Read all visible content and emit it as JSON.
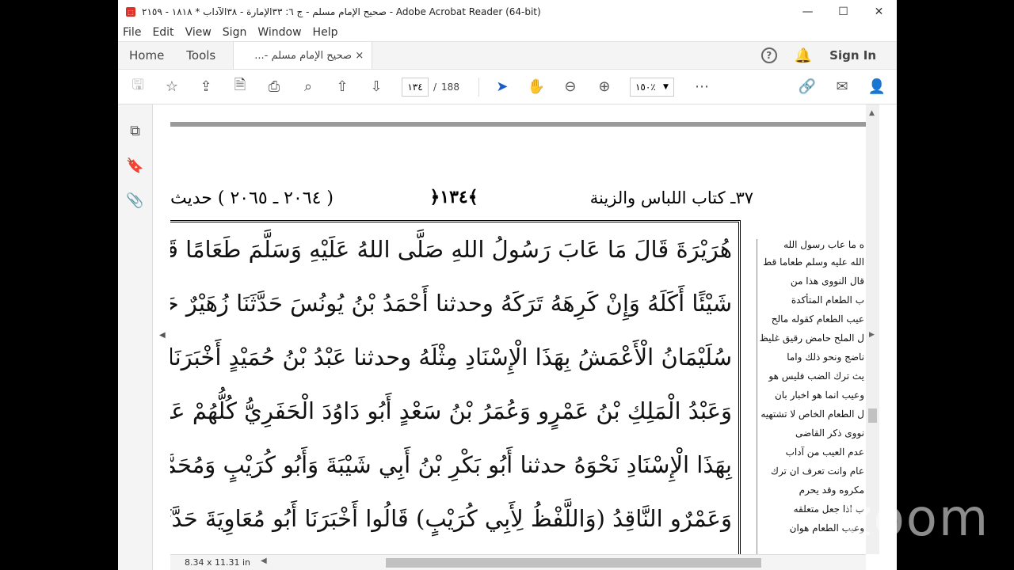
{
  "window": {
    "app_icon": "pdf-icon",
    "title": "صحيح الإمام مسلم - ج ٦: ٣٣الإمارة - ٣٨الآداب * ١٨١٨ - ٢١٥٩ - Adobe Acrobat Reader (64-bit)",
    "minimize": "—",
    "maximize": "☐",
    "close": "✕"
  },
  "menu": [
    "File",
    "Edit",
    "View",
    "Sign",
    "Window",
    "Help"
  ],
  "tabs": {
    "home": "Home",
    "tools": "Tools",
    "doc_tab": "صحيح الإمام مسلم -...",
    "doc_tab_close": "×",
    "help": "?",
    "sign_in": "Sign In"
  },
  "toolbar": {
    "page_current": "١٣٤",
    "page_separator": "/",
    "page_total": "188",
    "zoom": "١٥٠٪"
  },
  "document": {
    "header_left": "( ٢٠٦٤ ـ ٢٠٦٥ ) حديث",
    "header_center": "﴿١٣٤﴾",
    "header_right": "٣٧ـ كتاب اللباس والزينة",
    "lines": [
      "هُرَيْرَةَ قَالَ مَا عَابَ رَسُولُ اللهِ صَلَّى اللهُ عَلَيْهِ وَسَلَّمَ طَعَامًا قَطُّ كَانَ إِذَا اشْتَهَى",
      "شَيْئًا أَكَلَهُ وَإِنْ كَرِهَهُ تَرَكَهُ وحدثنا أَحْمَدُ بْنُ يُونُسَ حَدَّثَنَا زُهَيْرٌ حَدَّثَنَا",
      "سُلَيْمَانُ الْأَعْمَشُ بِهَذَا الْإِسْنَادِ مِثْلَهُ وحدثنا عَبْدُ بْنُ حُمَيْدٍ أَخْبَرَنَا عَبْدُ الرَّزَّاقِ",
      "وَعَبْدُ الْمَلِكِ بْنُ عَمْرٍو وَعُمَرُ بْنُ سَعْدٍ أَبُو دَاوُدَ الْحَفَرِيُّ كُلُّهُمْ عَنْ سُفْيَانَ عَنِ الْأَعْمَشِ",
      "بِهَذَا الْإِسْنَادِ نَحْوَهُ حدثنا أَبُو بَكْرِ بْنُ أَبِي شَيْبَةَ وَأَبُو كُرَيْبٍ وَمُحَمَّدُ بْنُ الْمُثَنَّى",
      "وَعَمْرٌو النَّاقِدُ (وَاللَّفْظُ لِأَبِي كُرَيْبٍ) قَالُوا أَخْبَرَنَا أَبُو مُعَاوِيَةَ حَدَّثَنَا الْأَعْمَشُ"
    ],
    "side_lines": [
      "ه ما عاب رسول الله",
      "الله عليه وسلم طعاما قط",
      "قال النووى هذا من",
      "ب الطعام المتأكدة",
      "عيب الطعام كقوله مالح",
      "ل الملح حامض رقيق غليظ",
      "ناضج ونحو ذلك واما",
      "يث ترك الضب فليس هو",
      "وعيب انما هو اخبار بان",
      "ل الطعام الخاص لا تشتهيه",
      "نووى ذكر القاضى",
      "عدم العيب من آداب",
      "عام وانت تعرف ان ترك",
      "مكروه وقد يحرم",
      "ب اذا جعل متعلقه",
      "وعيب الطعام هوان"
    ],
    "page_size": "8.34 x 11.31 in"
  },
  "watermark": "zoom"
}
